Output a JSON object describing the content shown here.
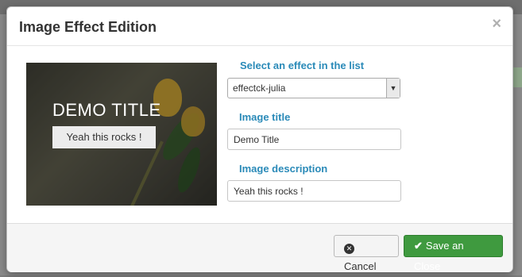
{
  "modal": {
    "title": "Image Effect Edition",
    "close_icon": "close-icon"
  },
  "preview": {
    "title": "DEMO TITLE",
    "description": "Yeah this rocks !"
  },
  "form": {
    "effect_label": "Select an effect in the list",
    "effect_value": "effectck-julia",
    "image_title_label": "Image title",
    "image_title_value": "Demo Title",
    "image_description_label": "Image description",
    "image_description_value": "Yeah this rocks !"
  },
  "footer": {
    "cancel_label": "Cancel",
    "cancel_icon": "x-circle-icon",
    "save_label": "Save an Close",
    "save_icon": "checkmark-icon"
  },
  "colors": {
    "label": "#2a8ab8",
    "save_button": "#3f9a3f",
    "title": "#333333"
  }
}
